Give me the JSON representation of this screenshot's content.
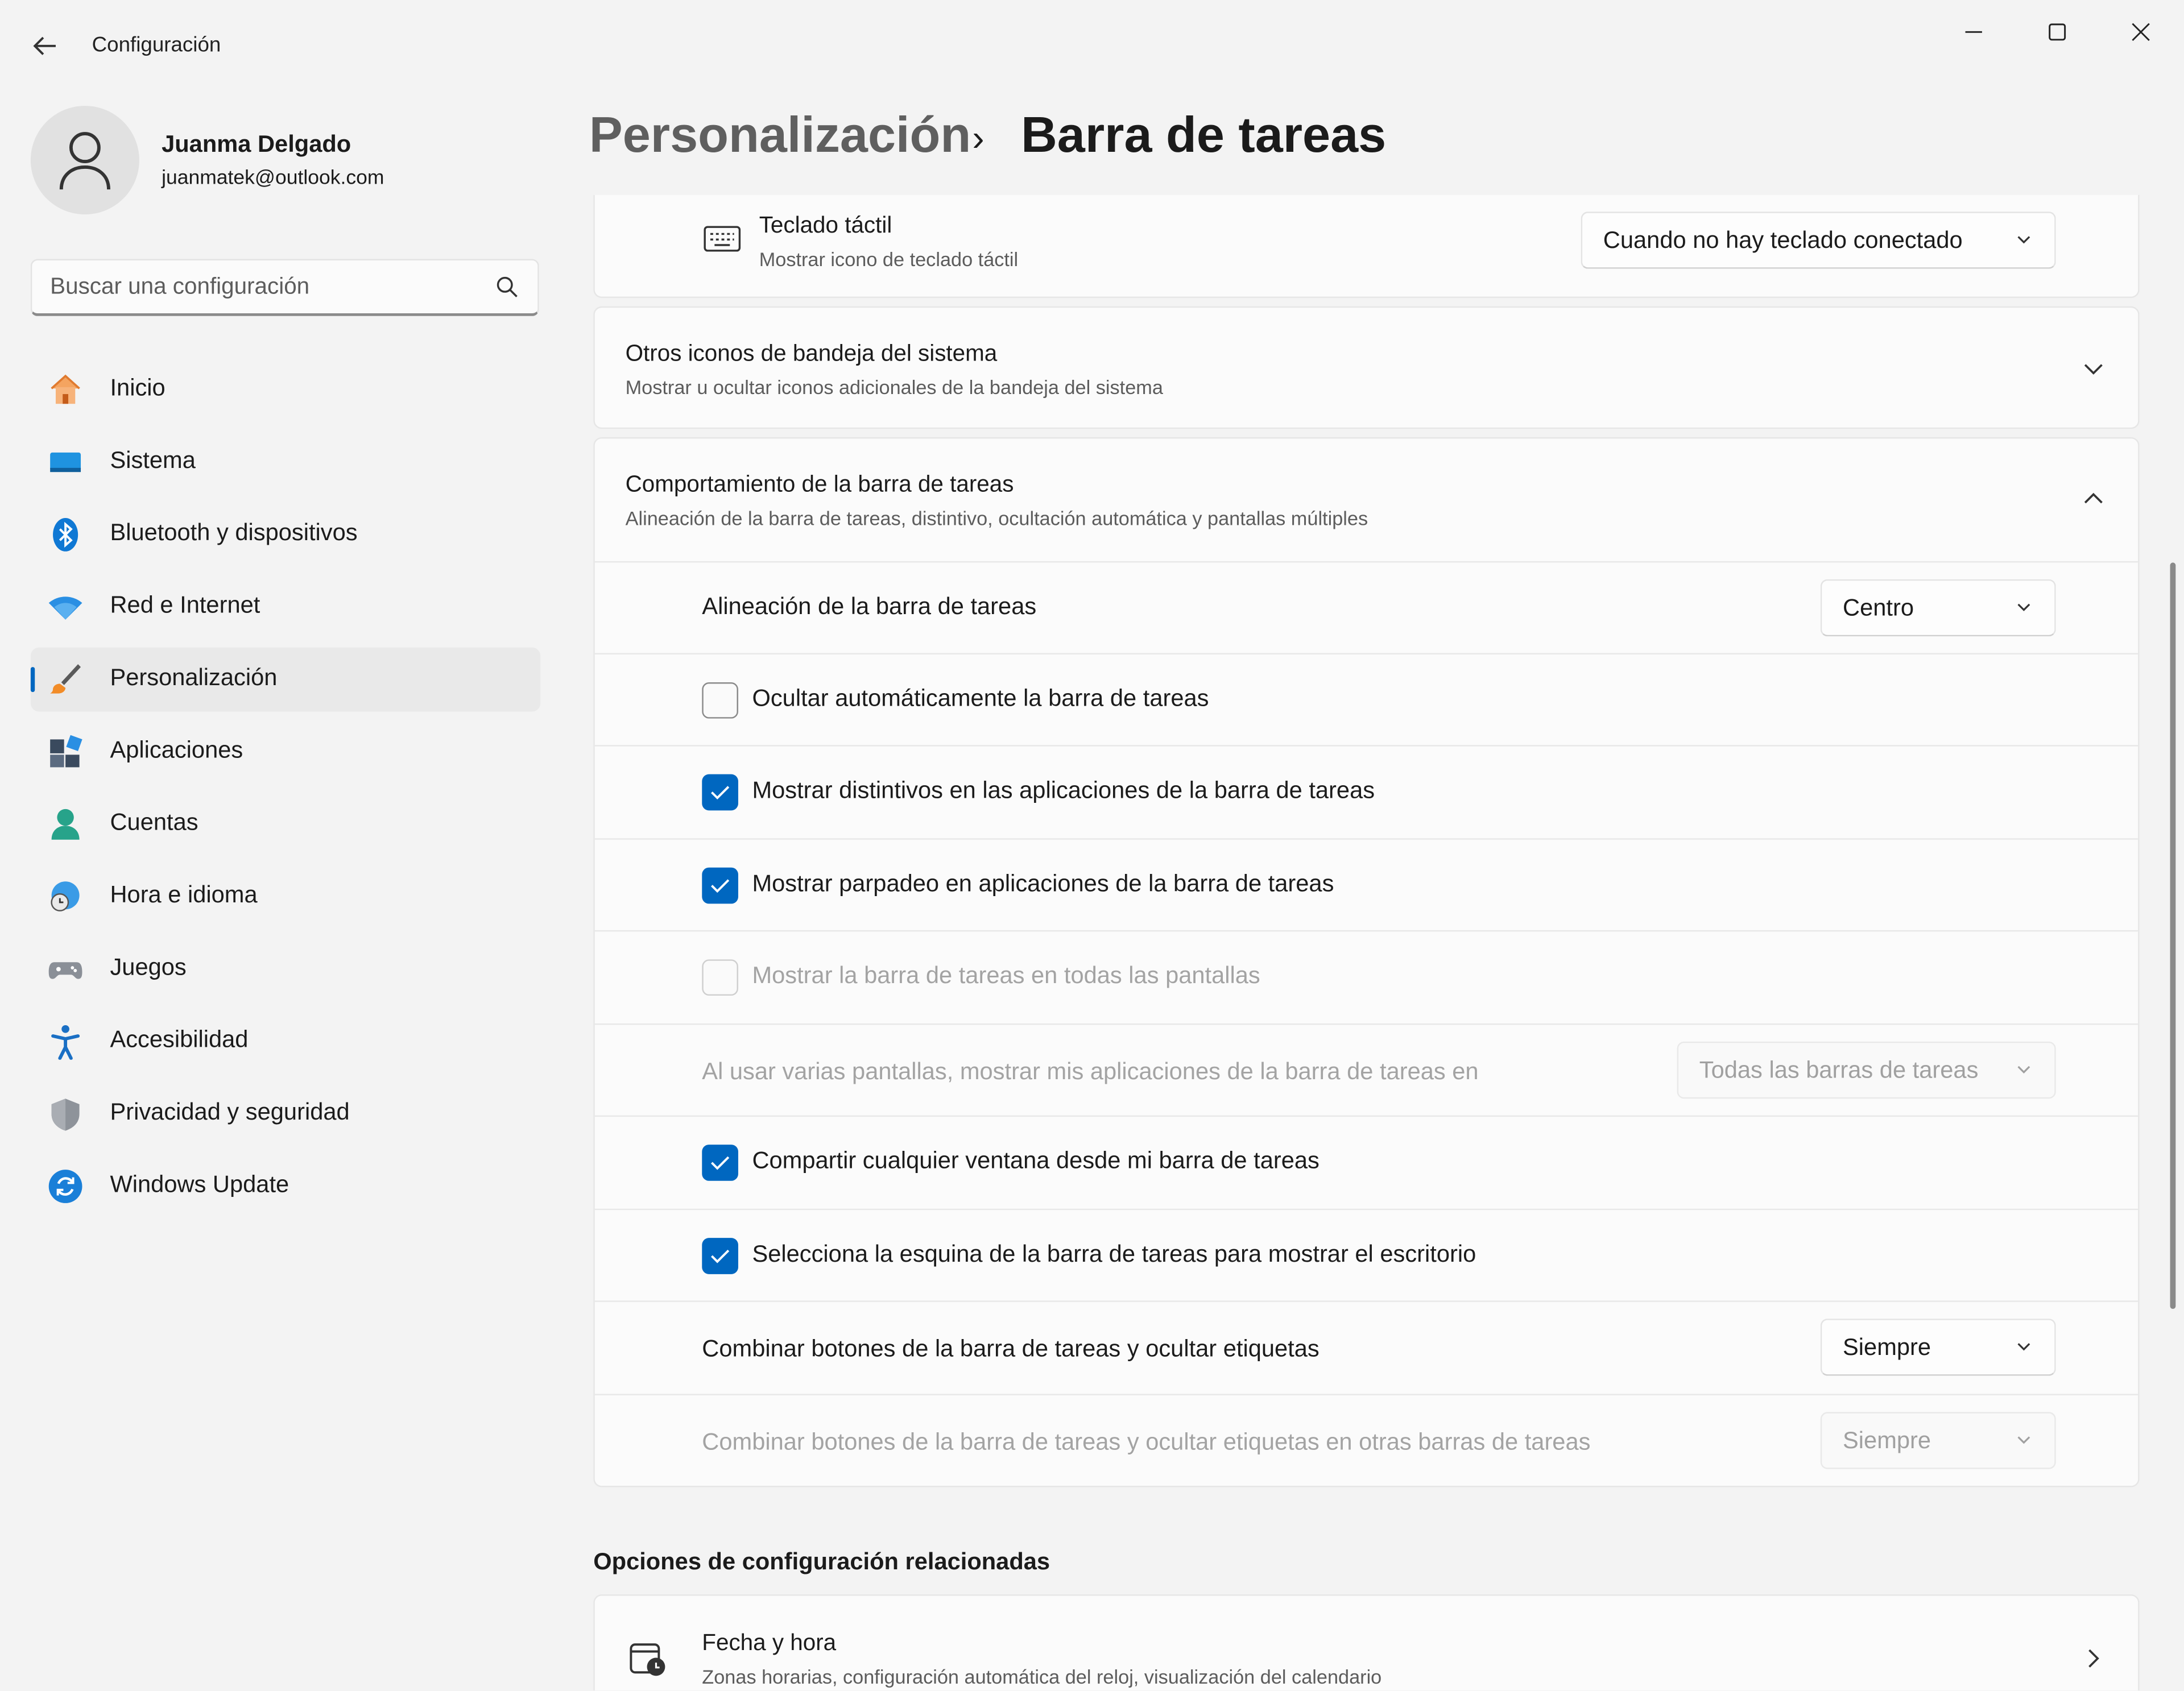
{
  "window": {
    "app_title": "Configuración",
    "back_icon": "arrow-left-icon",
    "minimize_icon": "minimize-icon",
    "maximize_icon": "maximize-icon",
    "close_icon": "close-icon"
  },
  "profile": {
    "name": "Juanma Delgado",
    "email": "juanmatek@outlook.com"
  },
  "search": {
    "placeholder": "Buscar una configuración"
  },
  "sidebar": {
    "items": [
      {
        "label": "Inicio",
        "icon": "home-icon",
        "active": false
      },
      {
        "label": "Sistema",
        "icon": "monitor-icon",
        "active": false
      },
      {
        "label": "Bluetooth y dispositivos",
        "icon": "bluetooth-icon",
        "active": false
      },
      {
        "label": "Red e Internet",
        "icon": "wifi-icon",
        "active": false
      },
      {
        "label": "Personalización",
        "icon": "brush-icon",
        "active": true
      },
      {
        "label": "Aplicaciones",
        "icon": "apps-icon",
        "active": false
      },
      {
        "label": "Cuentas",
        "icon": "person-icon",
        "active": false
      },
      {
        "label": "Hora e idioma",
        "icon": "globe-clock-icon",
        "active": false
      },
      {
        "label": "Juegos",
        "icon": "gamepad-icon",
        "active": false
      },
      {
        "label": "Accesibilidad",
        "icon": "accessibility-icon",
        "active": false
      },
      {
        "label": "Privacidad y seguridad",
        "icon": "shield-icon",
        "active": false
      },
      {
        "label": "Windows Update",
        "icon": "refresh-icon",
        "active": false
      }
    ]
  },
  "header": {
    "parent": "Personalización",
    "separator": "›",
    "current": "Barra de tareas"
  },
  "touch_keyboard": {
    "title": "Teclado táctil",
    "subtitle": "Mostrar icono de teclado táctil",
    "value": "Cuando no hay teclado conectado"
  },
  "tray_icons": {
    "title": "Otros iconos de bandeja del sistema",
    "subtitle": "Mostrar u ocultar iconos adicionales de la bandeja del sistema"
  },
  "behavior": {
    "title": "Comportamiento de la barra de tareas",
    "subtitle": "Alineación de la barra de tareas, distintivo, ocultación automática y pantallas múltiples",
    "alignment_label": "Alineación de la barra de tareas",
    "alignment_value": "Centro",
    "options": [
      {
        "label": "Ocultar automáticamente la barra de tareas",
        "checked": false,
        "enabled": true
      },
      {
        "label": "Mostrar distintivos en las aplicaciones de la barra de tareas",
        "checked": true,
        "enabled": true
      },
      {
        "label": "Mostrar parpadeo en aplicaciones de la barra de tareas",
        "checked": true,
        "enabled": true
      },
      {
        "label": "Mostrar la barra de tareas en todas las pantallas",
        "checked": false,
        "enabled": false
      }
    ],
    "multi_display_label": "Al usar varias pantallas, mostrar mis aplicaciones de la barra de tareas en",
    "multi_display_value": "Todas las barras de tareas",
    "share_label": "Compartir cualquier ventana desde mi barra de tareas",
    "share_checked": true,
    "corner_label": "Selecciona la esquina de la barra de tareas para mostrar el escritorio",
    "corner_checked": true,
    "combine_label": "Combinar botones de la barra de tareas y ocultar etiquetas",
    "combine_value": "Siempre",
    "combine_other_label": "Combinar botones de la barra de tareas y ocultar etiquetas en otras barras de tareas",
    "combine_other_value": "Siempre"
  },
  "related": {
    "heading": "Opciones de configuración relacionadas",
    "items": [
      {
        "title": "Fecha y hora",
        "subtitle": "Zonas horarias, configuración automática del reloj, visualización del calendario",
        "icon": "calendar-clock-icon"
      }
    ]
  },
  "colors": {
    "accent": "#0067c0",
    "background": "#f3f3f3",
    "card": "#fbfbfb"
  }
}
